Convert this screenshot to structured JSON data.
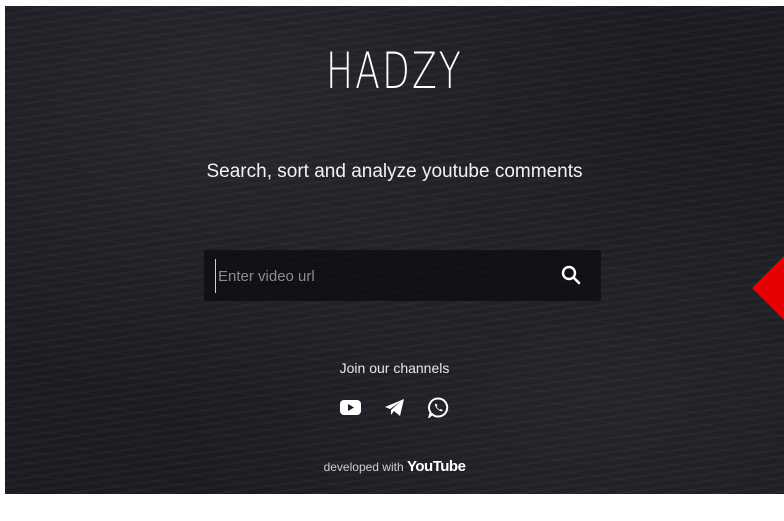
{
  "brand": {
    "title": "HADZY"
  },
  "hero": {
    "tagline": "Search, sort and analyze youtube comments"
  },
  "search": {
    "placeholder": "Enter video url",
    "value": "",
    "button_icon": "search-icon"
  },
  "channels": {
    "heading": "Join our channels",
    "items": [
      {
        "name": "youtube",
        "icon": "youtube-icon"
      },
      {
        "name": "telegram",
        "icon": "telegram-icon"
      },
      {
        "name": "whatsapp",
        "icon": "whatsapp-icon"
      }
    ]
  },
  "footer": {
    "prefix": "developed with",
    "brand": "YouTube"
  },
  "colors": {
    "background": "#1b1d23",
    "text": "#ffffff",
    "marker": "#e60000"
  }
}
